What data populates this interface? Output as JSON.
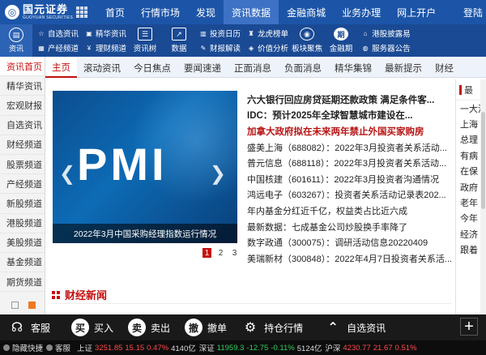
{
  "brand": {
    "name_cn": "国元证券",
    "name_en": "GUOYUAN SECURITIES"
  },
  "top_tabs": [
    {
      "label": "首页"
    },
    {
      "label": "行情市场"
    },
    {
      "label": "发现"
    },
    {
      "label": "资讯数据"
    },
    {
      "label": "金融商城"
    },
    {
      "label": "业务办理"
    },
    {
      "label": "网上开户"
    }
  ],
  "top_right": {
    "label": "登陆"
  },
  "toolbar": {
    "main": {
      "label": "资讯",
      "icon": "news-circle-icon"
    },
    "group1": [
      {
        "label": "自选资讯",
        "icon": "star-icon"
      },
      {
        "label": "产经频道",
        "icon": "industry-icon"
      },
      {
        "label": "精华资讯",
        "icon": "bookmark-icon"
      },
      {
        "label": "理财频道",
        "icon": "money-icon"
      }
    ],
    "big1": {
      "label": "资讯树",
      "icon": "tree-icon"
    },
    "big2": {
      "label": "数据",
      "icon": "chart-icon"
    },
    "group2": [
      {
        "label": "投资日历",
        "icon": "calendar-icon"
      },
      {
        "label": "财报解读",
        "icon": "report-icon"
      },
      {
        "label": "龙虎榜单",
        "icon": "dragon-icon"
      },
      {
        "label": "价值分析",
        "icon": "value-icon"
      }
    ],
    "big3": {
      "label": "板块聚焦",
      "icon": "eye-icon"
    },
    "big4": {
      "label": "金融期",
      "icon": "period-icon",
      "badge": "期"
    },
    "group3": [
      {
        "label": "港股披露易",
        "icon": "hk-icon"
      },
      {
        "label": "服务器公告",
        "icon": "server-icon"
      }
    ]
  },
  "sidebar": {
    "items": [
      {
        "label": "资讯首页"
      },
      {
        "label": "精华资讯"
      },
      {
        "label": "宏观财报"
      },
      {
        "label": "自选资讯"
      },
      {
        "label": "财经频道"
      },
      {
        "label": "股票频道"
      },
      {
        "label": "产经频道"
      },
      {
        "label": "新股频道"
      },
      {
        "label": "港股频道"
      },
      {
        "label": "美股频道"
      },
      {
        "label": "基金频道"
      },
      {
        "label": "期货频道"
      }
    ]
  },
  "subtabs": [
    {
      "label": "主页"
    },
    {
      "label": "滚动资讯"
    },
    {
      "label": "今日焦点"
    },
    {
      "label": "要闻速递"
    },
    {
      "label": "正面消息"
    },
    {
      "label": "负面消息"
    },
    {
      "label": "精华集锦"
    },
    {
      "label": "最新提示"
    },
    {
      "label": "财经"
    }
  ],
  "banner": {
    "headline": "PMI",
    "caption": "2022年3月中国采购经理指数运行情况",
    "pages": [
      "1",
      "2",
      "3"
    ],
    "active_page": 1
  },
  "news": [
    {
      "text": "六大银行回应房贷延期还款政策 满足条件客..."
    },
    {
      "text": "IDC：预计2025年全球智慧城市建设在..."
    },
    {
      "text": "加拿大政府拟在未来两年禁止外国买家购房"
    },
    {
      "text": "盛美上海（688082）：2022年3月投资者关系活动..."
    },
    {
      "text": "普元信息（688118）：2022年3月投资者关系活动..."
    },
    {
      "text": "中国核建（601611）：2022年3月投资者沟通情况"
    },
    {
      "text": "鸿远电子（603267）：投资者关系活动记录表202..."
    },
    {
      "text": "年内基金分红近千亿，权益类占比近六成"
    },
    {
      "text": "最新数据：七成基金公司炒股换手率降了"
    },
    {
      "text": "数字政通（300075）：调研活动信息20220409"
    },
    {
      "text": "美瑞新材（300848）：2022年4月7日投资者关系活..."
    }
  ],
  "right_column": {
    "title": "最",
    "rows": [
      "一大消",
      "上海",
      "总理",
      "有病",
      "在保",
      "政府",
      "老年",
      "今年",
      "经济",
      "跟着"
    ]
  },
  "finance_news": {
    "title": "财经新闻"
  },
  "trade_bar": [
    {
      "label": "客服",
      "icon": "headset-icon"
    },
    {
      "label": "买入",
      "icon": "buy-icon",
      "glyph": "买"
    },
    {
      "label": "卖出",
      "icon": "sell-icon",
      "glyph": "卖"
    },
    {
      "label": "撤单",
      "icon": "cancel-order-icon",
      "glyph": "撤"
    },
    {
      "label": "持仓行情",
      "icon": "position-icon"
    },
    {
      "label": "自选资讯",
      "icon": "watchlist-icon"
    }
  ],
  "status_bar": {
    "items": [
      {
        "label": "隐藏快捷"
      },
      {
        "label": "客服"
      }
    ],
    "indices": [
      {
        "name": "上证",
        "value": "3251.85",
        "change": "15.15",
        "pct": "0.47%",
        "amount": "4140亿",
        "dir": "up"
      },
      {
        "name": "深证",
        "value": "11959.3",
        "change": "-12.75",
        "pct": "-0.11%",
        "amount": "5124亿",
        "dir": "down"
      },
      {
        "name": "沪深",
        "value": "4230.77",
        "change": "21.67",
        "pct": "0.51%",
        "amount": "",
        "dir": "up"
      }
    ]
  },
  "colors": {
    "nav": "#1c55a8",
    "toolbar": "#1a4a94",
    "accent": "#c40e0e",
    "up": "#ff4a4a",
    "down": "#33d05a"
  }
}
